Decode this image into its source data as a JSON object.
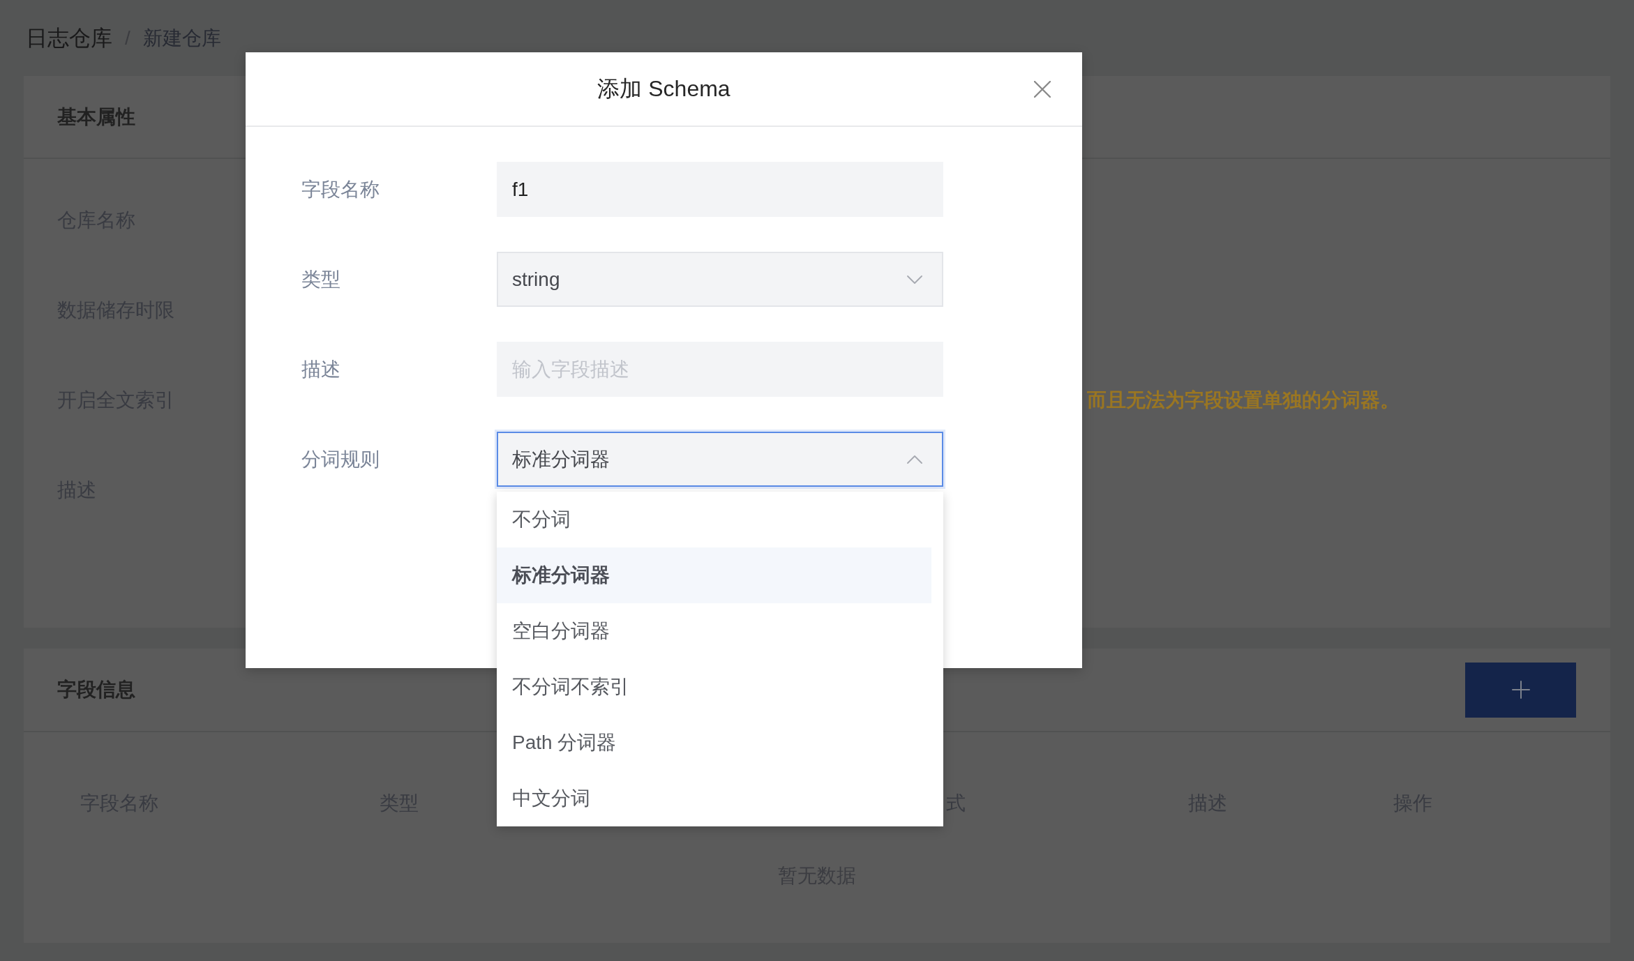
{
  "breadcrumb": {
    "separator": "/",
    "items": [
      {
        "label": "日志仓库",
        "current": false
      },
      {
        "label": "新建仓库",
        "current": true
      }
    ]
  },
  "basic_card": {
    "title": "基本属性",
    "fields": [
      {
        "label": "仓库名称"
      },
      {
        "label": "数据储存时限"
      },
      {
        "label": "开启全文索引",
        "note": "而且无法为字段设置单独的分词器。"
      },
      {
        "label": "描述"
      }
    ]
  },
  "fields_card": {
    "title": "字段信息",
    "table": {
      "columns": [
        "字段名称",
        "类型",
        "式",
        "描述",
        "操作"
      ],
      "empty_text": "暂无数据"
    }
  },
  "modal": {
    "title": "添加 Schema",
    "fields": [
      {
        "kind": "text",
        "label": "字段名称",
        "value": "f1"
      },
      {
        "kind": "select",
        "label": "类型",
        "value": "string",
        "expanded": false
      },
      {
        "kind": "text",
        "label": "描述",
        "placeholder": "输入字段描述"
      },
      {
        "kind": "select",
        "label": "分词规则",
        "value": "标准分词器",
        "expanded": true,
        "options": [
          {
            "label": "不分词",
            "selected": false
          },
          {
            "label": "标准分词器",
            "selected": true
          },
          {
            "label": "空白分词器",
            "selected": false
          },
          {
            "label": "不分词不索引",
            "selected": false
          },
          {
            "label": "Path 分词器",
            "selected": false
          },
          {
            "label": "中文分词",
            "selected": false
          }
        ]
      }
    ]
  }
}
